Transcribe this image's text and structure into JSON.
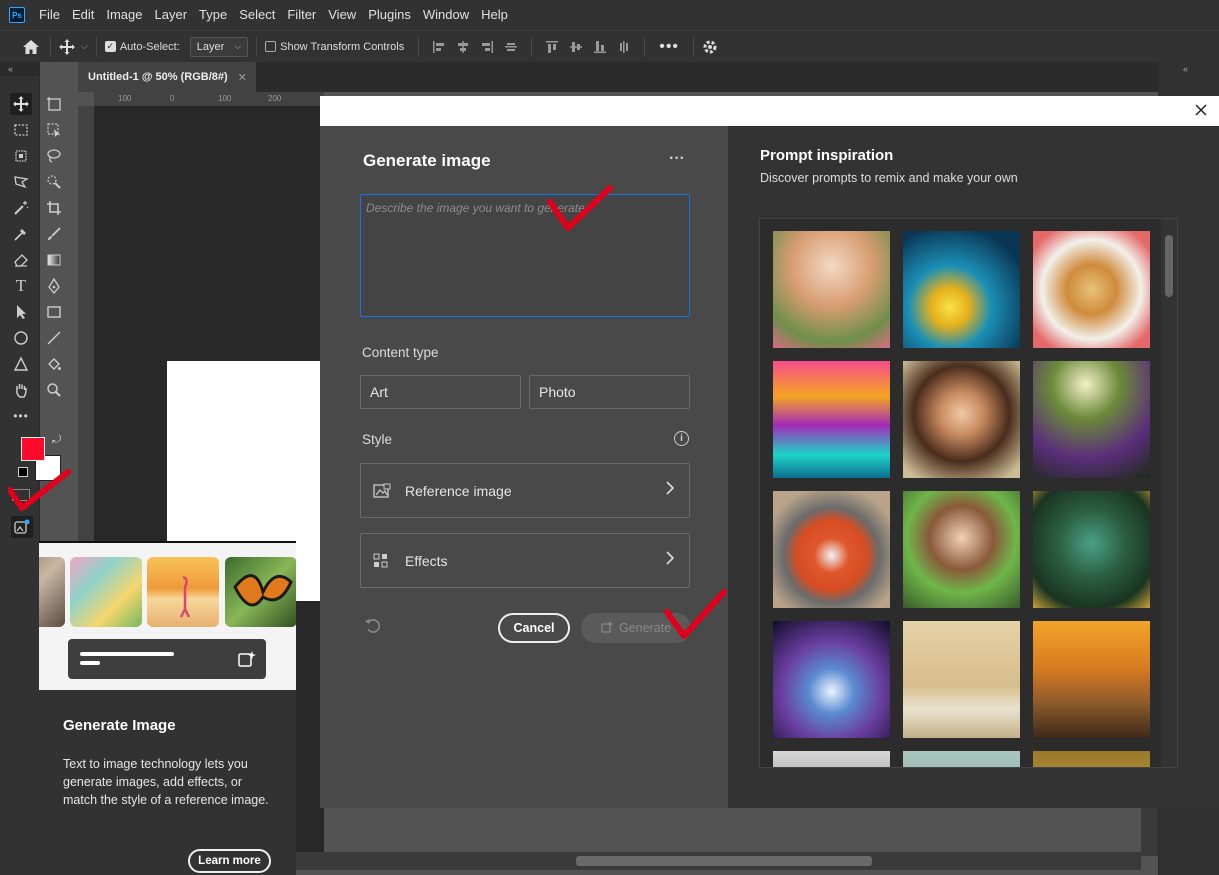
{
  "menubar": {
    "logo": "Ps",
    "items": [
      "File",
      "Edit",
      "Image",
      "Layer",
      "Type",
      "Select",
      "Filter",
      "View",
      "Plugins",
      "Window",
      "Help"
    ]
  },
  "options": {
    "auto_select_label": "Auto-Select:",
    "auto_select_target": "Layer",
    "show_transform_label": "Show Transform Controls"
  },
  "document": {
    "tab_title": "Untitled-1 @ 50% (RGB/8#)",
    "ruler_h": [
      "100",
      "0",
      "100",
      "200"
    ]
  },
  "tooltip": {
    "title": "Generate Image",
    "description": "Text to image technology lets you generate images, add effects, or match the style of a reference image.",
    "learn_more": "Learn more"
  },
  "dialog": {
    "title": "Generate image",
    "prompt_placeholder": "Describe the image you want to generate",
    "content_type_label": "Content type",
    "content_types": [
      "Art",
      "Photo"
    ],
    "style_label": "Style",
    "reference_image": "Reference image",
    "effects": "Effects",
    "cancel": "Cancel",
    "generate": "Generate"
  },
  "inspiration": {
    "title": "Prompt inspiration",
    "subtitle": "Discover prompts to remix and make your own"
  },
  "colors": {
    "foreground": "#ff0a2a",
    "background": "#ffffff",
    "accent_blue": "#1473e6",
    "checkmark_red": "#e0001b"
  }
}
